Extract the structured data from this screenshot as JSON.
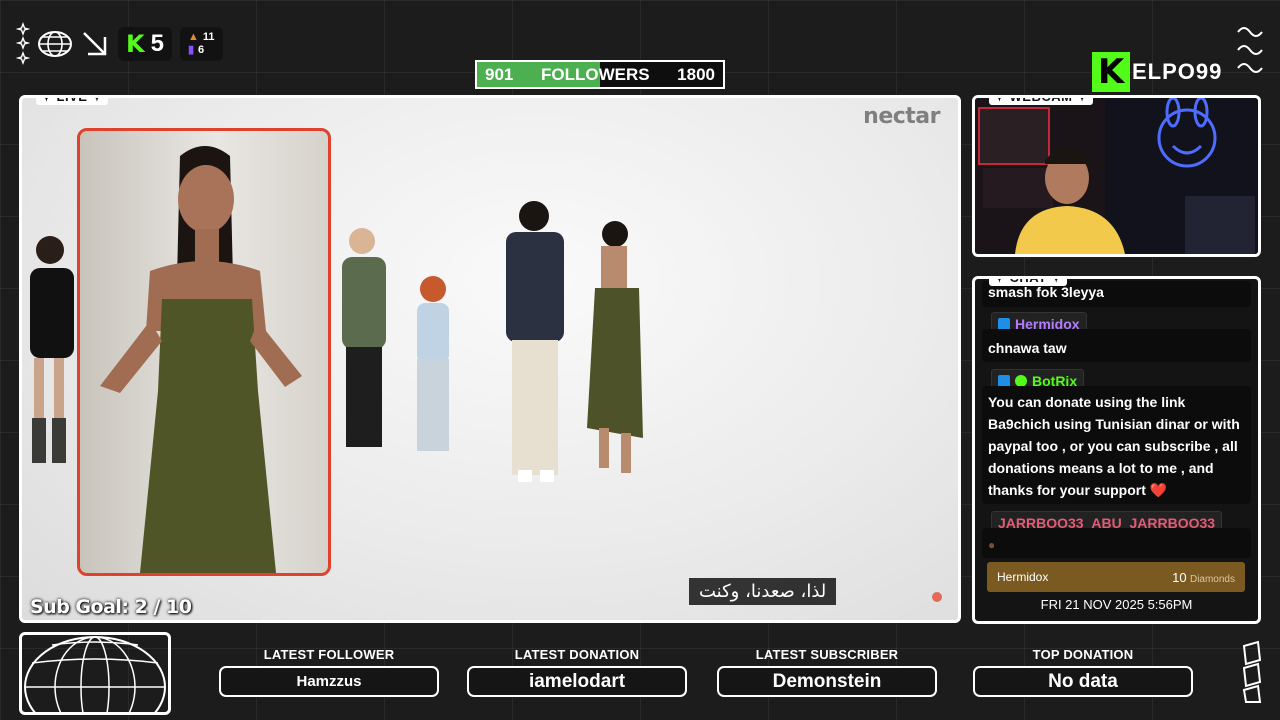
{
  "header": {
    "kick_letter": "K",
    "stream_count": "5",
    "stat_a": "11",
    "stat_b": "6"
  },
  "followers": {
    "current": "901",
    "label": "FOLLOWERS",
    "goal": "1800",
    "progress": 0.5,
    "fill_color": "#4caf50"
  },
  "brand": {
    "logo_letter": "K",
    "rest": "ELPO99",
    "accent": "#53fc18"
  },
  "main": {
    "label": "LIVE",
    "watermark": "nectar",
    "subtitle": "لذا، صعدنا، وكنت",
    "sub_goal": "Sub Goal:  2 / 10"
  },
  "webcam": {
    "label": "WEBCAM"
  },
  "chat": {
    "label": "CHAT",
    "messages": [
      {
        "text": "smash fok 3leyya"
      },
      {
        "user": "Hermidox",
        "user_color": "#b27cff",
        "text": "chnawa taw"
      },
      {
        "user": "BotRix",
        "user_color": "#53fc18",
        "text": "You can donate using the link Ba9chich using Tunisian dinar or with paypal too , or you can subscribe , all donations means a lot to me , and thanks for your support ❤️"
      },
      {
        "user": "JARRBOO33_ABU_JARRBOO33",
        "user_color": "#e45b78",
        "text": ""
      }
    ],
    "gift": {
      "user": "Hermidox",
      "amount": "10",
      "unit": "Diamonds"
    },
    "datetime": "FRI 21 NOV 2025 5:56PM"
  },
  "footer": {
    "latest_follower": {
      "title": "LATEST FOLLOWER",
      "value": "Hamzzus"
    },
    "latest_donation": {
      "title": "LATEST DONATION",
      "value": "iamelodart"
    },
    "latest_subscriber": {
      "title": "LATEST SUBSCRIBER",
      "value": "Demonstein"
    },
    "top_donation": {
      "title": "TOP DONATION",
      "value": "No data"
    }
  },
  "icons": [
    "sparkle-icon",
    "globe-icon",
    "arrow-down-right-icon",
    "kick-icon",
    "chart-icon",
    "wave-icon"
  ]
}
